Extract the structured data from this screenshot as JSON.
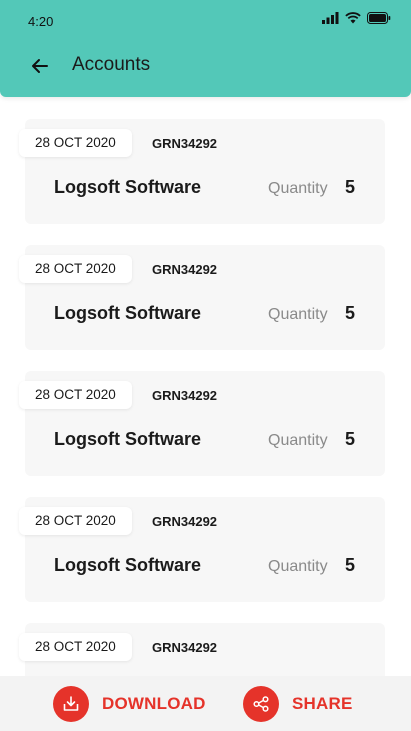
{
  "status_bar": {
    "time": "4:20"
  },
  "header": {
    "title": "Accounts"
  },
  "accounts": [
    {
      "date": "28 OCT 2020",
      "grn": "GRN34292",
      "company": "Logsoft Software",
      "quantity_label": "Quantity",
      "quantity": "5"
    },
    {
      "date": "28 OCT 2020",
      "grn": "GRN34292",
      "company": "Logsoft Software",
      "quantity_label": "Quantity",
      "quantity": "5"
    },
    {
      "date": "28 OCT 2020",
      "grn": "GRN34292",
      "company": "Logsoft Software",
      "quantity_label": "Quantity",
      "quantity": "5"
    },
    {
      "date": "28 OCT 2020",
      "grn": "GRN34292",
      "company": "Logsoft Software",
      "quantity_label": "Quantity",
      "quantity": "5"
    },
    {
      "date": "28 OCT 2020",
      "grn": "GRN34292",
      "company": "",
      "quantity_label": "",
      "quantity": ""
    }
  ],
  "bottom_bar": {
    "download_label": "DOWNLOAD",
    "share_label": "SHARE",
    "download_icon": "download-icon",
    "share_icon": "share-icon"
  },
  "colors": {
    "header": "#53c8b8",
    "accent": "#e5332a",
    "card": "#f7f7f7"
  }
}
